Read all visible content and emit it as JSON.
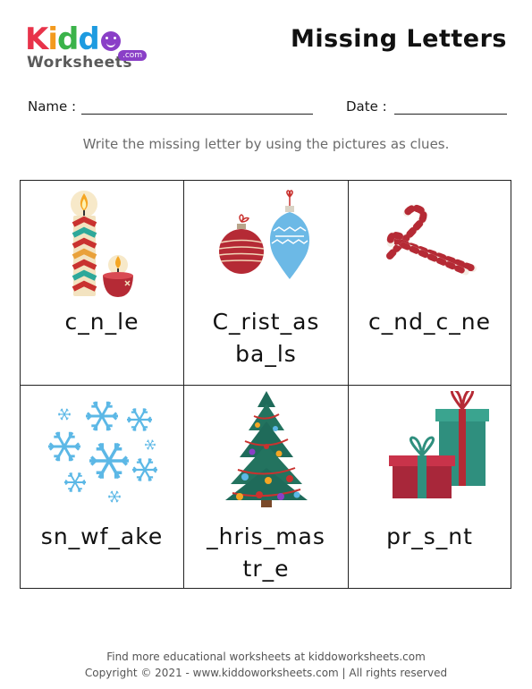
{
  "brand": {
    "kiddo": "Kidd",
    "worksheets": "Worksheets",
    "com": ".com"
  },
  "title": "Missing Letters",
  "form": {
    "name_label": "Name :",
    "date_label": "Date :"
  },
  "instructions": "Write the missing letter by using the pictures as clues.",
  "cells": [
    {
      "picture": "candle-icon",
      "line1": "c_n_le",
      "line2": ""
    },
    {
      "picture": "christmas-balls-icon",
      "line1": "C_rist_as",
      "line2": "ba_ls"
    },
    {
      "picture": "candy-cane-icon",
      "line1": "c_nd_c_ne",
      "line2": ""
    },
    {
      "picture": "snowflake-icon",
      "line1": "sn_wf_ake",
      "line2": ""
    },
    {
      "picture": "christmas-tree-icon",
      "line1": "_hris_mas",
      "line2": "tr_e"
    },
    {
      "picture": "present-icon",
      "line1": "pr_s_nt",
      "line2": ""
    }
  ],
  "footer": {
    "line1": "Find more educational worksheets at kiddoworksheets.com",
    "line2": "Copyright © 2021 - www.kiddoworksheets.com  |  All rights reserved"
  }
}
